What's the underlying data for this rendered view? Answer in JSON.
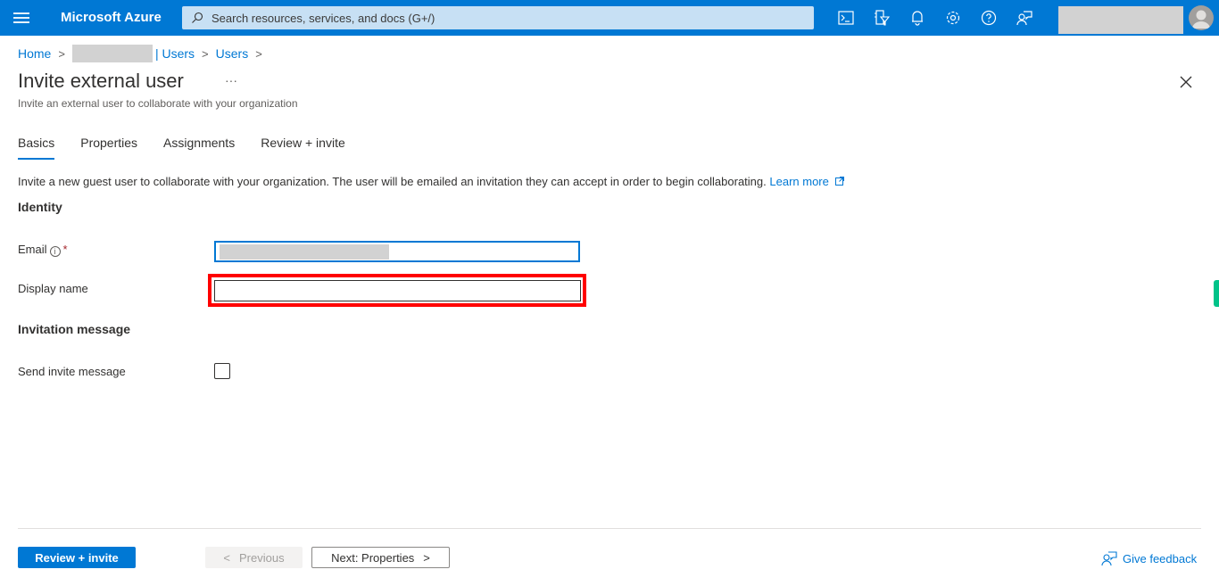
{
  "topbar": {
    "brand": "Microsoft Azure",
    "search_placeholder": "Search resources, services, and docs (G+/)",
    "icons": [
      "cloud-shell-icon",
      "directory-filter-icon",
      "notifications-icon",
      "settings-icon",
      "help-icon",
      "feedback-icon"
    ]
  },
  "breadcrumb": {
    "home": "Home",
    "tenant_suffix": "| Users",
    "users": "Users"
  },
  "page": {
    "title": "Invite external user",
    "more": "···",
    "subtitle": "Invite an external user to collaborate with your organization"
  },
  "tabs": [
    {
      "label": "Basics",
      "active": true
    },
    {
      "label": "Properties",
      "active": false
    },
    {
      "label": "Assignments",
      "active": false
    },
    {
      "label": "Review + invite",
      "active": false
    }
  ],
  "intro": {
    "text": "Invite a new guest user to collaborate with your organization. The user will be emailed an invitation they can accept in order to begin collaborating.",
    "link": "Learn more"
  },
  "form": {
    "identity_heading": "Identity",
    "email_label": "Email",
    "email_required": "*",
    "display_name_label": "Display name",
    "display_name_value": "",
    "invitation_heading": "Invitation message",
    "send_invite_label": "Send invite message",
    "send_invite_checked": false
  },
  "footer": {
    "review_invite": "Review + invite",
    "previous": "Previous",
    "next": "Next: Properties",
    "give_feedback": "Give feedback"
  },
  "colors": {
    "accent": "#0078d4",
    "highlight": "#ff0000"
  }
}
